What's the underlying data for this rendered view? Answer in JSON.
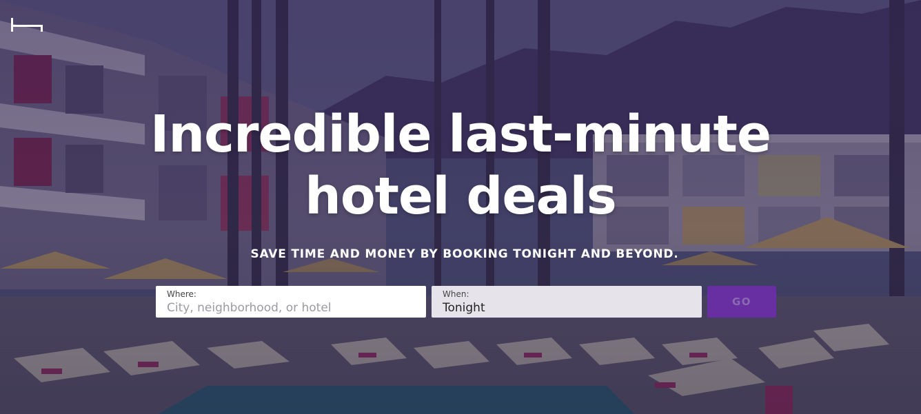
{
  "header": {
    "logo_icon": "bed-icon"
  },
  "hero": {
    "headline_line1": "Incredible last-minute",
    "headline_line2": "hotel deals",
    "tagline": "SAVE TIME AND MONEY BY BOOKING TONIGHT AND BEYOND."
  },
  "search": {
    "where": {
      "label": "Where:",
      "placeholder": "City, neighborhood, or hotel",
      "value": ""
    },
    "when": {
      "label": "When:",
      "value": "Tonight"
    },
    "go_label": "GO"
  },
  "colors": {
    "overlay": "#2a1f48",
    "accent": "#6a2fa6",
    "text": "#ffffff",
    "when_field_bg": "#e6e4ea"
  }
}
